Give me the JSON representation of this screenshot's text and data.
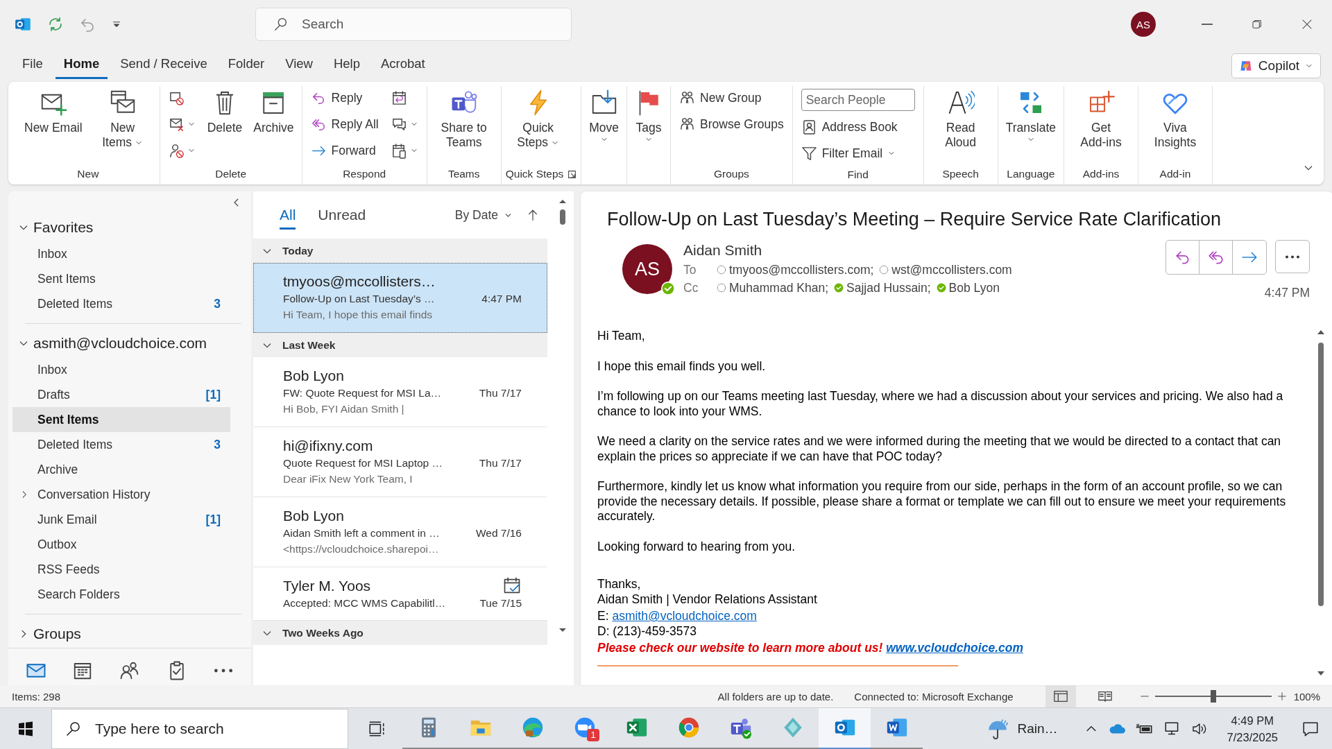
{
  "title_bar": {
    "search": {
      "placeholder": "Search"
    },
    "avatar": "AS"
  },
  "menu_tabs": [
    {
      "label": "File",
      "selected": false
    },
    {
      "label": "Home",
      "selected": true
    },
    {
      "label": "Send / Receive",
      "selected": false
    },
    {
      "label": "Folder",
      "selected": false
    },
    {
      "label": "View",
      "selected": false
    },
    {
      "label": "Help",
      "selected": false
    },
    {
      "label": "Acrobat",
      "selected": false
    }
  ],
  "copilot": {
    "label": "Copilot"
  },
  "ribbon": {
    "groups": [
      {
        "label": "New",
        "columns": [
          [
            {
              "kind": "large",
              "label": "New Email"
            }
          ],
          [
            {
              "kind": "large",
              "label": "New Items",
              "dropdown": true
            }
          ]
        ]
      },
      {
        "label": "Delete",
        "columns": [
          [
            {
              "kind": "icon"
            },
            {
              "kind": "icon",
              "dropdown": true
            },
            {
              "kind": "icon",
              "dropdown": true
            }
          ],
          [
            {
              "kind": "large",
              "label": "Delete"
            }
          ],
          [
            {
              "kind": "large",
              "label": "Archive"
            }
          ]
        ]
      },
      {
        "label": "Respond",
        "columns": [
          [
            {
              "kind": "small",
              "label": "Reply"
            },
            {
              "kind": "small",
              "label": "Reply All"
            },
            {
              "kind": "small",
              "label": "Forward"
            }
          ],
          [
            {
              "kind": "icon"
            },
            {
              "kind": "icon",
              "dropdown": true
            },
            {
              "kind": "icon",
              "dropdown": true
            }
          ]
        ]
      },
      {
        "label": "Teams",
        "columns": [
          [
            {
              "kind": "large",
              "label": "Share to Teams"
            }
          ]
        ]
      },
      {
        "label": "Quick Steps",
        "launcher": true,
        "columns": [
          [
            {
              "kind": "large",
              "label": "Quick Steps",
              "dropdown": true
            }
          ]
        ]
      },
      {
        "columns": [
          [
            {
              "kind": "large",
              "label": "Move",
              "dropdown": true
            }
          ]
        ]
      },
      {
        "columns": [
          [
            {
              "kind": "large",
              "label": "Tags",
              "dropdown": true
            }
          ]
        ]
      },
      {
        "label": "Groups",
        "columns": [
          [
            {
              "kind": "small",
              "label": "New Group"
            },
            {
              "kind": "small",
              "label": "Browse Groups"
            }
          ]
        ]
      },
      {
        "label": "Find",
        "columns": [
          [
            {
              "kind": "search",
              "placeholder": "Search People"
            },
            {
              "kind": "small",
              "label": "Address Book"
            },
            {
              "kind": "small",
              "label": "Filter Email",
              "dropdown": true
            }
          ]
        ]
      },
      {
        "label": "Speech",
        "columns": [
          [
            {
              "kind": "large",
              "label": "Read Aloud"
            }
          ]
        ]
      },
      {
        "label": "Language",
        "columns": [
          [
            {
              "kind": "large",
              "label": "Translate",
              "dropdown": true
            }
          ]
        ]
      },
      {
        "label": "Add-ins",
        "columns": [
          [
            {
              "kind": "large",
              "label": "Get Add-ins"
            }
          ]
        ]
      },
      {
        "label": "Add-in",
        "columns": [
          [
            {
              "kind": "large",
              "label": "Viva Insights"
            }
          ]
        ]
      }
    ]
  },
  "nav": {
    "sections": [
      {
        "label": "Favorites",
        "expanded": true,
        "folders": [
          {
            "label": "Inbox",
            "selected": false
          },
          {
            "label": "Sent Items",
            "selected": false
          },
          {
            "label": "Deleted Items",
            "count": "3",
            "selected": false
          }
        ]
      },
      {
        "label": "asmith@vcloudchoice.com",
        "expanded": true,
        "folders": [
          {
            "label": "Inbox",
            "selected": false
          },
          {
            "label": "Drafts",
            "count": "[1]",
            "selected": false
          },
          {
            "label": "Sent Items",
            "selected": true
          },
          {
            "label": "Deleted Items",
            "count": "3",
            "selected": false
          },
          {
            "label": "Archive",
            "selected": false
          },
          {
            "label": "Conversation History",
            "expanded": false,
            "selected": false
          },
          {
            "label": "Junk Email",
            "count": "[1]",
            "selected": false
          },
          {
            "label": "Outbox",
            "selected": false
          },
          {
            "label": "RSS Feeds",
            "selected": false
          },
          {
            "label": "Search Folders",
            "selected": false
          }
        ]
      },
      {
        "label": "Groups",
        "expanded": false
      }
    ],
    "modules": [
      {
        "selected": true
      },
      {
        "selected": false
      },
      {
        "selected": false
      },
      {
        "selected": false
      },
      {
        "selected": false
      }
    ]
  },
  "message_list": {
    "filters": [
      {
        "label": "All",
        "selected": true
      },
      {
        "label": "Unread",
        "selected": false
      }
    ],
    "sort": "By Date",
    "groups": [
      {
        "label": "Today",
        "expanded": true,
        "messages": [
          {
            "kind": "mail",
            "sender": "tmyoos@mccollisters…",
            "subject": "Follow-Up on Last Tuesday’s …",
            "preview": "Hi Team,  I hope this email finds",
            "time": "4:47 PM",
            "selected": true
          }
        ]
      },
      {
        "label": "Last Week",
        "expanded": true,
        "messages": [
          {
            "kind": "mail",
            "sender": "Bob Lyon",
            "subject": "FW: Quote Request for MSI La…",
            "preview": "Hi Bob,  FYI  Aidan Smith |",
            "time": "Thu 7/17",
            "selected": false
          },
          {
            "kind": "mail",
            "sender": "hi@ifixny.com",
            "subject": "Quote Request for MSI Laptop …",
            "preview": "Dear iFix New York Team,  I",
            "time": "Thu 7/17",
            "selected": false
          },
          {
            "kind": "mail",
            "sender": "Bob Lyon",
            "subject": "Aidan Smith left a comment in …",
            "preview": "<https://vcloudchoice.sharepoi…",
            "time": "Wed 7/16",
            "selected": false
          },
          {
            "kind": "meeting",
            "sender": "Tyler M. Yoos",
            "subject": "Accepted: MCC WMS Capabilitl…",
            "time": "Tue 7/15",
            "selected": false
          }
        ]
      },
      {
        "label": "Two Weeks Ago",
        "expanded": true
      }
    ]
  },
  "reader": {
    "subject": "Follow-Up on Last Tuesday’s Meeting – Require Service Rate Clarification",
    "avatar": "AS",
    "sender": "Aidan Smith",
    "time": "4:47 PM",
    "to": {
      "label": "To",
      "recipients": [
        {
          "name": "tmyoos@mccollisters.com;",
          "available": false
        },
        {
          "name": "wst@mccollisters.com",
          "available": false
        }
      ]
    },
    "cc": {
      "label": "Cc",
      "recipients": [
        {
          "name": "Muhammad Khan;",
          "available": false
        },
        {
          "name": "Sajjad Hussain;",
          "available": true
        },
        {
          "name": "Bob Lyon",
          "available": true
        }
      ]
    },
    "body": [
      "Hi Team,",
      "I hope this email finds you well.",
      "I’m following up on our Teams meeting last Tuesday, where we had a discussion about your services and pricing. We also had a chance to look into your WMS.",
      "We need a clarity on the service rates and we were informed during the meeting that we would be directed to a contact that can explain the prices so appreciate if we can have that POC today?",
      "Furthermore, kindly let us know what information you require from our side, perhaps in the form of an account profile, so we can provide the necessary details. If possible, please share a format or template we can fill out to ensure we meet your requirements accurately.",
      "Looking forward to hearing from you."
    ],
    "signature": [
      {
        "kind": "line",
        "text": "Thanks,"
      },
      {
        "kind": "line",
        "text": "Aidan Smith | Vendor Relations Assistant"
      },
      {
        "kind": "contact",
        "text": "E:",
        "link": "asmith@vcloudchoice.com"
      },
      {
        "kind": "line",
        "text": "D: (213)-459-3573"
      },
      {
        "kind": "promo",
        "text": "Please check our website to learn more about us!",
        "link": "www.vcloudchoice.com"
      }
    ]
  },
  "status_bar": {
    "items": "Items: 298",
    "sync": "All folders are up to date.",
    "connection": "Connected to: Microsoft Exchange",
    "views": [
      {
        "selected": true
      },
      {
        "selected": false
      }
    ],
    "zoom": {
      "level": 0.5,
      "reading": "100%"
    }
  },
  "taskbar": {
    "search": {
      "placeholder": "Type here to search"
    },
    "apps": [
      {
        "selected": false
      },
      {
        "selected": false
      },
      {
        "selected": false
      },
      {
        "selected": false,
        "badge": "1"
      },
      {
        "selected": false
      },
      {
        "selected": false
      },
      {
        "selected": false
      },
      {
        "selected": false
      },
      {
        "selected": true
      },
      {
        "selected": false
      }
    ],
    "weather": "Rain…",
    "time": "4:49 PM",
    "date": "7/23/2025"
  }
}
